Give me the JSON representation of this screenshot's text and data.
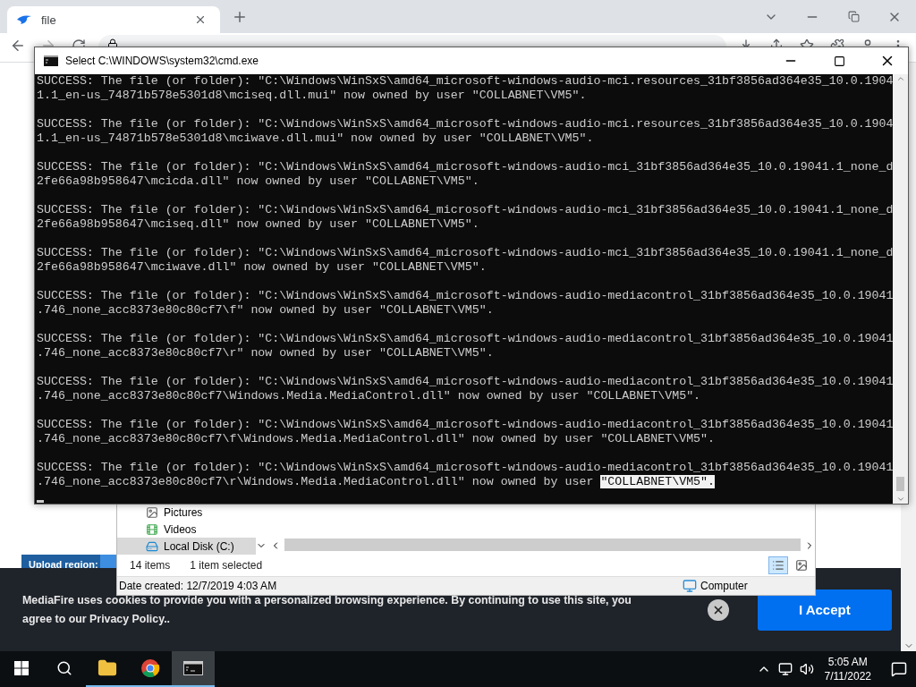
{
  "browser": {
    "tab": {
      "title": "file"
    },
    "page": {
      "upload_region_label": "Upload region:",
      "cookie_banner": {
        "text": "MediaFire uses cookies to provide you with a personalized browsing experience. By continuing to use this site, you agree to our Privacy Policy..",
        "button": "I Accept"
      }
    }
  },
  "cmd_window": {
    "title": "Select C:\\WINDOWS\\system32\\cmd.exe",
    "entries": [
      {
        "line1": "SUCCESS: The file (or folder): \"C:\\Windows\\WinSxS\\amd64_microsoft-windows-audio-mci.resources_31bf3856ad364e35_10.0.1904",
        "line2": "1.1_en-us_74871b578e5301d8\\mciseq.dll.mui\" now owned by user \"COLLABNET\\VM5\"."
      },
      {
        "line1": "SUCCESS: The file (or folder): \"C:\\Windows\\WinSxS\\amd64_microsoft-windows-audio-mci.resources_31bf3856ad364e35_10.0.1904",
        "line2": "1.1_en-us_74871b578e5301d8\\mciwave.dll.mui\" now owned by user \"COLLABNET\\VM5\"."
      },
      {
        "line1": "SUCCESS: The file (or folder): \"C:\\Windows\\WinSxS\\amd64_microsoft-windows-audio-mci_31bf3856ad364e35_10.0.19041.1_none_d",
        "line2": "2fe66a98b958647\\mcicda.dll\" now owned by user \"COLLABNET\\VM5\"."
      },
      {
        "line1": "SUCCESS: The file (or folder): \"C:\\Windows\\WinSxS\\amd64_microsoft-windows-audio-mci_31bf3856ad364e35_10.0.19041.1_none_d",
        "line2": "2fe66a98b958647\\mciseq.dll\" now owned by user \"COLLABNET\\VM5\"."
      },
      {
        "line1": "SUCCESS: The file (or folder): \"C:\\Windows\\WinSxS\\amd64_microsoft-windows-audio-mci_31bf3856ad364e35_10.0.19041.1_none_d",
        "line2": "2fe66a98b958647\\mciwave.dll\" now owned by user \"COLLABNET\\VM5\"."
      },
      {
        "line1": "SUCCESS: The file (or folder): \"C:\\Windows\\WinSxS\\amd64_microsoft-windows-audio-mediacontrol_31bf3856ad364e35_10.0.19041",
        "line2": ".746_none_acc8373e80c80cf7\\f\" now owned by user \"COLLABNET\\VM5\"."
      },
      {
        "line1": "SUCCESS: The file (or folder): \"C:\\Windows\\WinSxS\\amd64_microsoft-windows-audio-mediacontrol_31bf3856ad364e35_10.0.19041",
        "line2": ".746_none_acc8373e80c80cf7\\r\" now owned by user \"COLLABNET\\VM5\"."
      },
      {
        "line1": "SUCCESS: The file (or folder): \"C:\\Windows\\WinSxS\\amd64_microsoft-windows-audio-mediacontrol_31bf3856ad364e35_10.0.19041",
        "line2": ".746_none_acc8373e80c80cf7\\Windows.Media.MediaControl.dll\" now owned by user \"COLLABNET\\VM5\"."
      },
      {
        "line1": "SUCCESS: The file (or folder): \"C:\\Windows\\WinSxS\\amd64_microsoft-windows-audio-mediacontrol_31bf3856ad364e35_10.0.19041",
        "line2": ".746_none_acc8373e80c80cf7\\f\\Windows.Media.MediaControl.dll\" now owned by user \"COLLABNET\\VM5\"."
      },
      {
        "line1": "SUCCESS: The file (or folder): \"C:\\Windows\\WinSxS\\amd64_microsoft-windows-audio-mediacontrol_31bf3856ad364e35_10.0.19041",
        "line2": ".746_none_acc8373e80c80cf7\\r\\Windows.Media.MediaControl.dll\" now owned by user ",
        "selection": "\"COLLABNET\\VM5\"."
      }
    ]
  },
  "explorer": {
    "nav_items": [
      {
        "kind": "pictures",
        "label": "Pictures",
        "selected": false
      },
      {
        "kind": "videos",
        "label": "Videos",
        "selected": false
      },
      {
        "kind": "disk",
        "label": "Local Disk (C:)",
        "selected": true
      }
    ],
    "item_count": "14 items",
    "selection": "1 item selected",
    "date_created": "Date created: 12/7/2019 4:03 AM",
    "location": "Computer"
  },
  "taskbar": {
    "apps": [
      {
        "kind": "explorer",
        "active": false
      },
      {
        "kind": "chrome",
        "active": false
      },
      {
        "kind": "cmd",
        "active": true
      }
    ],
    "time": "5:05 AM",
    "date": "7/11/2022"
  }
}
